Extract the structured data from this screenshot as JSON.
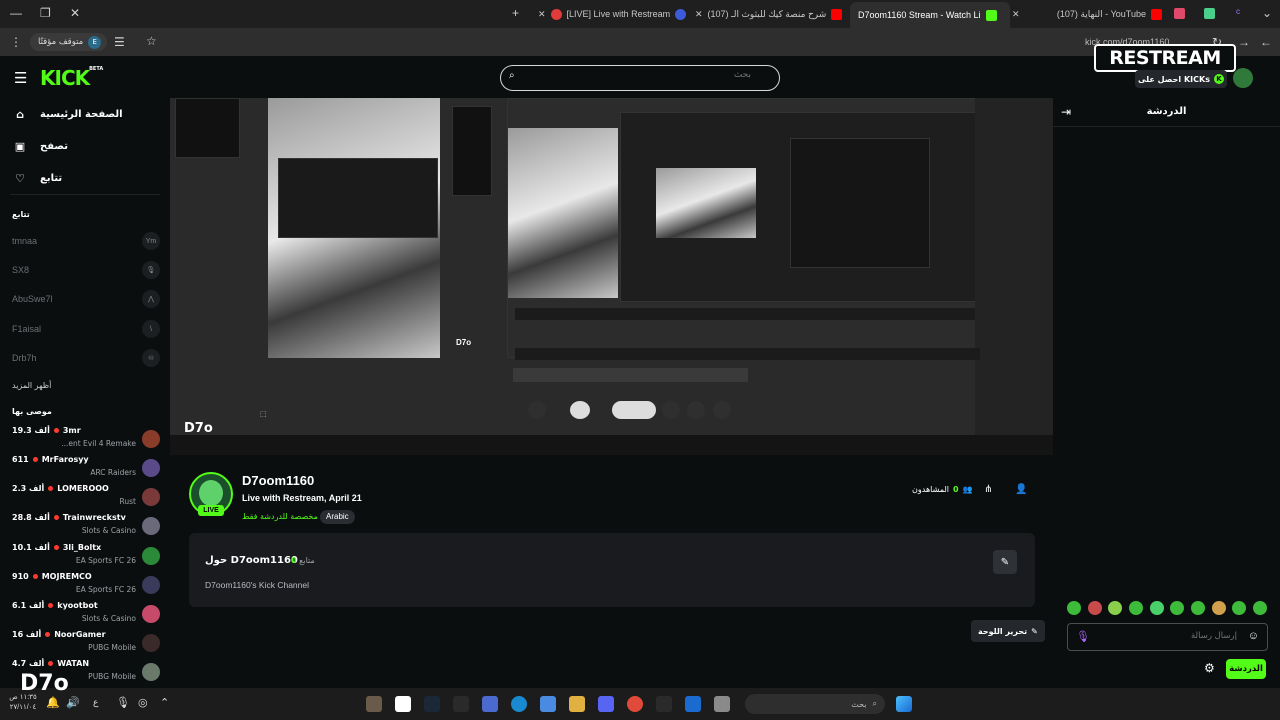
{
  "browser": {
    "tabs": [
      {
        "title": "[LIVE] Live with Restream",
        "color": "#e23b3b"
      },
      {
        "title": "(107) شرح منصة كيك للبثوث الـ",
        "color": "#ff0000"
      },
      {
        "title": "D7oom1160 Stream - Watch Li",
        "color": "#53fc18"
      },
      {
        "title": "(107) النهاية - YouTube",
        "color": "#ff0000"
      }
    ],
    "url": "kick.com/d7oom1160",
    "paused_label": "متوقف مؤقتًا",
    "profile_letter": "E"
  },
  "header": {
    "logo": "KICK",
    "logo_beta": "BETA",
    "search_placeholder": "بحث",
    "watermark": "RESTREAM",
    "get_kicks": "احصل على KICKs"
  },
  "sidebar": {
    "nav": [
      {
        "label": "الصفحة الرئيسية",
        "icon": "home-icon"
      },
      {
        "label": "تصفح",
        "icon": "browse-icon"
      },
      {
        "label": "تتابع",
        "icon": "heart-icon"
      }
    ],
    "following_title": "تتابع",
    "following": [
      {
        "name": "tmnaa",
        "avatar": "Ym"
      },
      {
        "name": "SX8",
        "avatar": "🎙"
      },
      {
        "name": "AbuSwe7l",
        "avatar": "⋀"
      },
      {
        "name": "F1aisal",
        "avatar": "\\"
      },
      {
        "name": "Drb7h",
        "avatar": "♾"
      }
    ],
    "show_more": "أظهر المزيد",
    "recommended_title": "موصى بها",
    "recommended": [
      {
        "name": "3mr",
        "viewers": "19.3 ألف",
        "category": "...ent Evil 4 Remake",
        "color": "#8a3c2a"
      },
      {
        "name": "MrFarosyy",
        "viewers": "611",
        "category": "ARC Raiders",
        "color": "#5a4a8a"
      },
      {
        "name": "LOMEROOO",
        "viewers": "2.3 ألف",
        "category": "Rust",
        "color": "#7a3a3a"
      },
      {
        "name": "Trainwreckstv",
        "viewers": "28.8 ألف",
        "category": "Slots & Casino",
        "color": "#6a6a7a"
      },
      {
        "name": "3li_Boltx",
        "viewers": "10.1 ألف",
        "category": "EA Sports FC 26",
        "color": "#2a8a3a"
      },
      {
        "name": "MOJREMCO",
        "viewers": "910",
        "category": "EA Sports FC 26",
        "color": "#3a3a5a"
      },
      {
        "name": "kyootbot",
        "viewers": "6.1 ألف",
        "category": "Slots & Casino",
        "color": "#c84a6a"
      },
      {
        "name": "NoorGamer",
        "viewers": "16 ألف",
        "category": "PUBG Mobile",
        "color": "#3a2a2a"
      },
      {
        "name": "WATAN",
        "viewers": "4.7 ألف",
        "category": "PUBG Mobile",
        "color": "#6a7a6a"
      }
    ]
  },
  "stream": {
    "watermark": "D7o",
    "channel_name": "D7oom1160",
    "title": "Live with Restream, April 21",
    "chat_mode": "مخصصة للدردشة فقط",
    "language": "Arabic",
    "live_label": "LIVE",
    "viewers_label": "المشاهدون",
    "viewers_count": "0",
    "about_title": "حول D7oom1160",
    "followers_count": "0",
    "followers_label": "متابع",
    "description": "D7oom1160's Kick Channel",
    "edit_panels": "تحرير اللوحة"
  },
  "chat": {
    "title": "الدردشة",
    "input_placeholder": "إرسال رسالة",
    "send_label": "الدردشة"
  },
  "taskbar": {
    "search_placeholder": "بحث",
    "time": "١١:٣٥ ص",
    "date": "٢٧/١١/٠٤",
    "lang": "ع"
  }
}
